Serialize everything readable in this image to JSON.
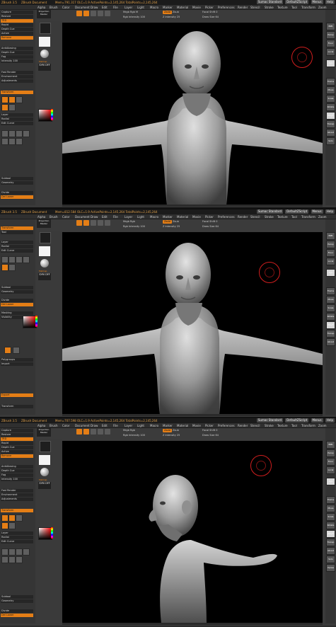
{
  "app": {
    "title": "ZBrush 3.5",
    "document": "ZBrush Document",
    "brush": "Sumac Standard",
    "skin": "DefaultZScript",
    "buttons": [
      "Menus",
      "Help"
    ]
  },
  "status": [
    "Mem=791.317 OLC=1.9 ActivePoints=2,145,264 TotalPoints=2,145,264",
    "Mem=812.584 OLC=1.9 ActivePoints=2,145,264 TotalPoints=2,145,264",
    "Mem=707.598 OLC=1.9 ActivePoints=2,145,264 TotalPoints=2,145,264"
  ],
  "menus": [
    "Alpha",
    "Brush",
    "Color",
    "Document",
    "Draw",
    "Edit",
    "File",
    "Layer",
    "Light",
    "Macro",
    "Marker",
    "Material",
    "Movie",
    "Picker",
    "Preferences",
    "Render",
    "Stencil",
    "Stroke",
    "Texture",
    "Tool",
    "Transform",
    "Zoom",
    "Zplugin",
    "Zscript"
  ],
  "toolbar": {
    "projection_master": "Projection Master",
    "tool_buttons": [
      "Edit",
      "Draw",
      "Move",
      "Scale",
      "Rotate"
    ],
    "mrgb": "Mrgb",
    "rgb": "Rgb",
    "m": "M",
    "zadd": "Zadd",
    "zsub": "Zsub",
    "zcut": "Zcut",
    "rgb_intensity": "Rgb Intensity 100",
    "z_intensity": "Z Intensity 25",
    "focal_shift": "Focal Shift 0",
    "draw_size": "Draw Size 64"
  },
  "left_palette": {
    "rows_top": [
      "Capture",
      "Restore",
      "TRD",
      "Rapid",
      "Depth Cue",
      "Active",
      "Remove",
      "Smart Bg",
      "Transform"
    ],
    "rows_mid": [
      "AntiAliasing",
      "Depth Cue",
      "Fog",
      "Intensity 100",
      "Depth Adj",
      "Flat",
      "Fast Render",
      "Environment",
      "Adjustments"
    ],
    "rows_low": [
      "Transform",
      "Tool",
      "Layer",
      "Mesh",
      "Radial",
      "Smooth",
      "Edit Curve"
    ],
    "rows_bottom": [
      "Subtool",
      "Geometry",
      "Divide",
      "Del Lower",
      "Masking",
      "Visibility",
      "Polygroups",
      "Import",
      "Export"
    ],
    "section_labels": [
      "Lightbox",
      "Render",
      "Tool",
      "SubTool"
    ]
  },
  "side_column": {
    "material_label": "MatCap",
    "xyz_label": "SYM OFF"
  },
  "right_shelf": [
    "BPR",
    "Persp",
    "Floor",
    "Local",
    "Xyz",
    "Frame",
    "Move",
    "Scale",
    "Rotate",
    "PolyF",
    "Transp",
    "Ghost",
    "Solo",
    "Xpose"
  ]
}
